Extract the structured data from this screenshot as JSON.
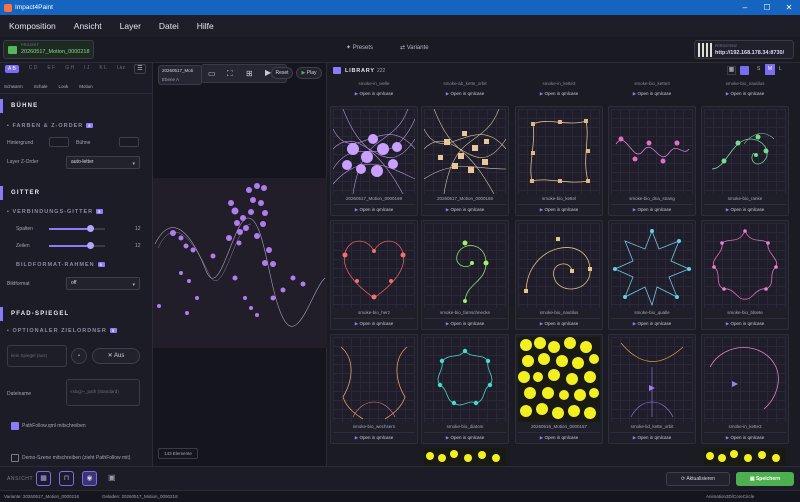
{
  "window": {
    "title": "Impact4Paint"
  },
  "menu": [
    "Komposition",
    "Ansicht",
    "Layer",
    "Datei",
    "Hilfe"
  ],
  "topbar": {
    "project_label": "PROJEKT",
    "project_value": "20260517_Motion_0000218",
    "presets_label": "Presets",
    "variants_label": "Variante",
    "url_label": "PERSISTENZ",
    "url_value": "http://192.168.178.34:8730/"
  },
  "left": {
    "layer_selector": [
      "A B",
      "C D",
      "E F",
      "G H",
      "I J",
      "K L",
      "Lez"
    ],
    "tabs": [
      "Schwarm",
      "Schale",
      "Look",
      "Motion"
    ],
    "sections": {
      "buehne": "BÜHNE",
      "farben": "FARBEN & Z-ORDER",
      "farben_badge": "5",
      "hintergrund": "Hintergrund",
      "buehne_color": "Bühne",
      "zorder_label": "Layer Z-Order",
      "zorder_value": "auto-letter",
      "gitter": "GITTER",
      "vg": "VERBINDUNGS-GITTER",
      "vg_badge": "5",
      "spalten": "Spalten",
      "spalten_value": "12",
      "zeilen": "Zeilen",
      "zeilen_value": "12",
      "bildformat_rahmen": "BILDFORMAT-RAHMEN",
      "bildformat_badge": "5",
      "bildformat_label": "Bildformat",
      "bildformat_value": "off",
      "pfad": "PFAD-SPIEGEL",
      "optionaler": "OPTIONALER ZIELORDNER",
      "optionaler_badge": "5",
      "spiegel_placeholder": "kein Spiegel (aus)",
      "aus_label": "Aus",
      "dateiname_label": "Dateiname",
      "dateiname_placeholder": "<slug>-_path (Standard)",
      "pathfollow_label": "PathFollow.qml mitschreiben",
      "demo_label": "Demo-Szene mitschreiben (zieht PathFollow mit)"
    }
  },
  "center": {
    "file_label": "20260517_Moti",
    "layer_label": "Ebene A",
    "reset_label": "Reset",
    "play_label": "Play",
    "elements_label": "143 Elemente"
  },
  "library": {
    "title": "LIBRARY",
    "count": "222",
    "sizes": [
      "S",
      "M",
      "L"
    ],
    "top_row": [
      "smoke-in_welle",
      "smoke-ab_kette_orbit",
      "smoke-in_kette3",
      "smoke-bio_kette3",
      "smoke-bio_nautilus"
    ],
    "open_label": "Open in qmlcase",
    "cards": [
      {
        "name": "20260517_Motion_0000169"
      },
      {
        "name": "20260517_Motion_0000168"
      },
      {
        "name": "smoke-bio_kettel"
      },
      {
        "name": "smoke-bio_dna_strang"
      },
      {
        "name": "smoke-bio_ranke"
      },
      {
        "name": "smoke-bio_herz"
      },
      {
        "name": "smoke-bio_farnschnecke"
      },
      {
        "name": "smoke-bio_nautilus"
      },
      {
        "name": "smoke-bio_qualle"
      },
      {
        "name": "smoke-bio_blüete"
      },
      {
        "name": "smoke-bio_wechsern"
      },
      {
        "name": "smoke-bio_diatom"
      },
      {
        "name": "20260516_Motion_0000157"
      },
      {
        "name": "smoke-lid_kette_orbit"
      },
      {
        "name": "smoke-in_kette3"
      }
    ]
  },
  "bottom": {
    "ansicht_label": "ANSICHT",
    "aktualisieren_label": "Aktualisieren",
    "speichern_label": "Speichern",
    "status_variante": "Variante: 20260517_Motion_0000218",
    "status_geladen": "Geladen: 20260517_Motion_0000218",
    "status_right": "Animation3D/CoreCircle"
  }
}
